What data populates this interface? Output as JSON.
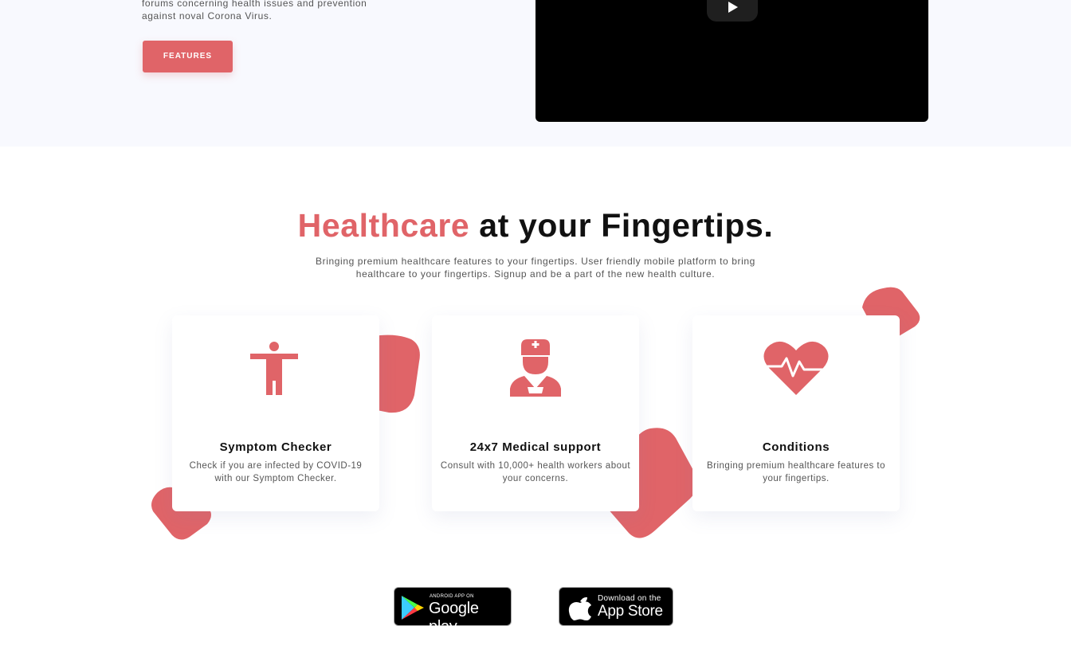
{
  "hero": {
    "text": "forums concerning health issues and prevention against noval Corona Virus.",
    "features_button": "FEATURES"
  },
  "headline": {
    "accent": "Healthcare",
    "rest": " at your Fingertips."
  },
  "subtext": "Bringing premium healthcare features to your fingertips. User friendly mobile platform to bring healthcare to your fingertips. Signup and be a part of the new health culture.",
  "cards": [
    {
      "icon": "person-icon",
      "title": "Symptom Checker",
      "desc": "Check if you are infected by COVID-19 with our Symptom Checker."
    },
    {
      "icon": "doctor-icon",
      "title": "24x7 Medical support",
      "desc": "Consult with 10,000+ health workers about your concerns."
    },
    {
      "icon": "heartbeat-icon",
      "title": "Conditions",
      "desc": "Bringing premium healthcare features to your fingertips."
    }
  ],
  "stores": {
    "google_small": "ANDROID APP ON",
    "google_big": "Google play",
    "apple_small": "Download on the",
    "apple_big": "App Store"
  },
  "colors": {
    "accent": "#e06468",
    "hero_bg": "#f8f9fe"
  }
}
